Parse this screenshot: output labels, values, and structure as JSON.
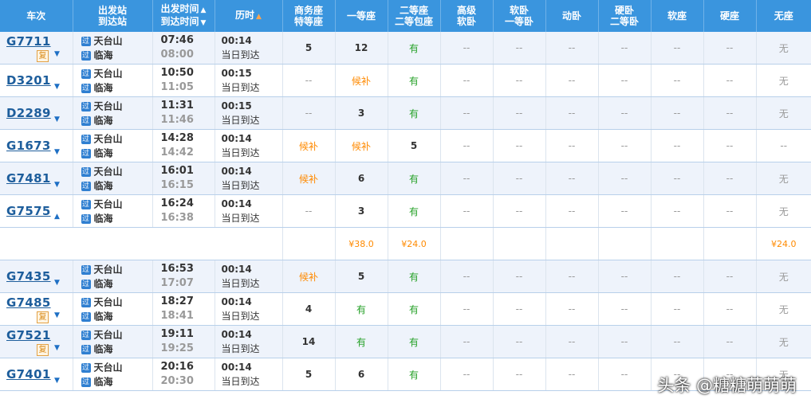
{
  "header": {
    "train": "车次",
    "stations": [
      "出发站",
      "到达站"
    ],
    "times": [
      "出发时间",
      "到达时间"
    ],
    "duration": "历时",
    "business": [
      "商务座",
      "特等座"
    ],
    "first": "一等座",
    "second": [
      "二等座",
      "二等包座"
    ],
    "adv_soft": [
      "高级",
      "软卧"
    ],
    "soft_first": [
      "软卧",
      "一等卧"
    ],
    "dong": "动卧",
    "hard_second": [
      "硬卧",
      "二等卧"
    ],
    "soft_seat": "软座",
    "hard_seat": "硬座",
    "no_seat": "无座"
  },
  "icons": {
    "sort_up_down": "sort-up-down-icon",
    "sort_up": "sort-up-icon",
    "pass_station": "过",
    "fu_badge": "复",
    "caret_down": "▼",
    "caret_up": "▲"
  },
  "colors": {
    "header_bg": "#3a95de",
    "row_alt": "#eef3fb",
    "train_no": "#1e5e9c",
    "available": "#26a128",
    "waitlist": "#ff8a00",
    "price": "#ff8a00"
  },
  "rows": [
    {
      "train": "G7711",
      "fu": "复",
      "caret": "▼",
      "from": "天台山",
      "to": "临海",
      "dep": "07:46",
      "arr": "08:00",
      "dur": "00:14",
      "day": "当日到达",
      "seats": [
        "5",
        "12",
        "有",
        "--",
        "--",
        "--",
        "--",
        "--",
        "--",
        "无"
      ]
    },
    {
      "train": "D3201",
      "fu": "",
      "caret": "▼",
      "from": "天台山",
      "to": "临海",
      "dep": "10:50",
      "arr": "11:05",
      "dur": "00:15",
      "day": "当日到达",
      "seats": [
        "--",
        "候补",
        "有",
        "--",
        "--",
        "--",
        "--",
        "--",
        "--",
        "无"
      ]
    },
    {
      "train": "D2289",
      "fu": "",
      "caret": "▼",
      "from": "天台山",
      "to": "临海",
      "dep": "11:31",
      "arr": "11:46",
      "dur": "00:15",
      "day": "当日到达",
      "seats": [
        "--",
        "3",
        "有",
        "--",
        "--",
        "--",
        "--",
        "--",
        "--",
        "无"
      ]
    },
    {
      "train": "G1673",
      "fu": "",
      "caret": "▼",
      "from": "天台山",
      "to": "临海",
      "dep": "14:28",
      "arr": "14:42",
      "dur": "00:14",
      "day": "当日到达",
      "seats": [
        "候补",
        "候补",
        "5",
        "--",
        "--",
        "--",
        "--",
        "--",
        "--",
        "--"
      ]
    },
    {
      "train": "G7481",
      "fu": "",
      "caret": "▼",
      "from": "天台山",
      "to": "临海",
      "dep": "16:01",
      "arr": "16:15",
      "dur": "00:14",
      "day": "当日到达",
      "seats": [
        "候补",
        "6",
        "有",
        "--",
        "--",
        "--",
        "--",
        "--",
        "--",
        "无"
      ]
    },
    {
      "train": "G7575",
      "fu": "",
      "caret": "▲",
      "from": "天台山",
      "to": "临海",
      "dep": "16:24",
      "arr": "16:38",
      "dur": "00:14",
      "day": "当日到达",
      "seats": [
        "--",
        "3",
        "有",
        "--",
        "--",
        "--",
        "--",
        "--",
        "--",
        "无"
      ]
    },
    {
      "train": "G7435",
      "fu": "",
      "caret": "▼",
      "from": "天台山",
      "to": "临海",
      "dep": "16:53",
      "arr": "17:07",
      "dur": "00:14",
      "day": "当日到达",
      "seats": [
        "候补",
        "5",
        "有",
        "--",
        "--",
        "--",
        "--",
        "--",
        "--",
        "无"
      ]
    },
    {
      "train": "G7485",
      "fu": "复",
      "caret": "▼",
      "from": "天台山",
      "to": "临海",
      "dep": "18:27",
      "arr": "18:41",
      "dur": "00:14",
      "day": "当日到达",
      "seats": [
        "4",
        "有",
        "有",
        "--",
        "--",
        "--",
        "--",
        "--",
        "--",
        "无"
      ]
    },
    {
      "train": "G7521",
      "fu": "复",
      "caret": "▼",
      "from": "天台山",
      "to": "临海",
      "dep": "19:11",
      "arr": "19:25",
      "dur": "00:14",
      "day": "当日到达",
      "seats": [
        "14",
        "有",
        "有",
        "--",
        "--",
        "--",
        "--",
        "--",
        "--",
        "无"
      ]
    },
    {
      "train": "G7401",
      "fu": "",
      "caret": "▼",
      "from": "天台山",
      "to": "临海",
      "dep": "20:16",
      "arr": "20:30",
      "dur": "00:14",
      "day": "当日到达",
      "seats": [
        "5",
        "6",
        "有",
        "--",
        "--",
        "--",
        "--",
        "--",
        "--",
        "无"
      ]
    }
  ],
  "price_row": {
    "after_row": 5,
    "prices": [
      "",
      "¥38.0",
      "¥24.0",
      "",
      "",
      "",
      "",
      "",
      "",
      "¥24.0"
    ]
  },
  "watermark": "头条 @糖糖萌萌萌"
}
